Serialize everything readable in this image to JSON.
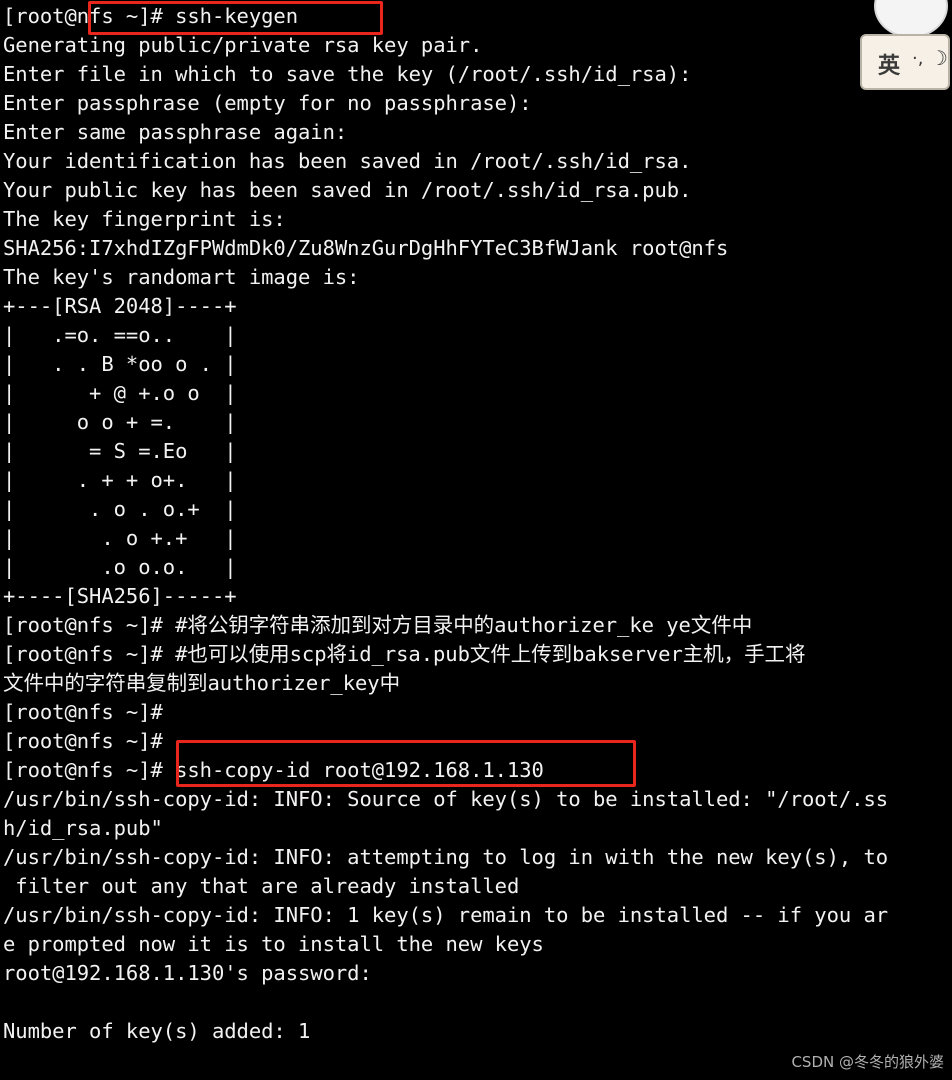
{
  "terminal": {
    "lines": [
      "[root@nfs ~]# ssh-keygen",
      "Generating public/private rsa key pair.",
      "Enter file in which to save the key (/root/.ssh/id_rsa):",
      "Enter passphrase (empty for no passphrase):",
      "Enter same passphrase again:",
      "Your identification has been saved in /root/.ssh/id_rsa.",
      "Your public key has been saved in /root/.ssh/id_rsa.pub.",
      "The key fingerprint is:",
      "SHA256:I7xhdIZgFPWdmDk0/Zu8WnzGurDgHhFYTeC3BfWJank root@nfs",
      "The key's randomart image is:",
      "+---[RSA 2048]----+",
      "|   .=o. ==o..    |",
      "|   . . B *oo o . |",
      "|      + @ +.o o  |",
      "|     o o + =.    |",
      "|      = S =.Eo   |",
      "|     . + + o+.   |",
      "|      . o . o.+  |",
      "|       . o +.+   |",
      "|       .o o.o.   |",
      "+----[SHA256]-----+",
      "[root@nfs ~]# #将公钥字符串添加到对方目录中的authorizer_ke ye文件中",
      "[root@nfs ~]# #也可以使用scp将id_rsa.pub文件上传到bakserver主机，手工将",
      "文件中的字符串复制到authorizer_key中",
      "[root@nfs ~]#",
      "[root@nfs ~]#",
      "[root@nfs ~]# ssh-copy-id root@192.168.1.130",
      "/usr/bin/ssh-copy-id: INFO: Source of key(s) to be installed: \"/root/.ss",
      "h/id_rsa.pub\"",
      "/usr/bin/ssh-copy-id: INFO: attempting to log in with the new key(s), to",
      " filter out any that are already installed",
      "/usr/bin/ssh-copy-id: INFO: 1 key(s) remain to be installed -- if you ar",
      "e prompted now it is to install the new keys",
      "root@192.168.1.130's password:",
      "",
      "Number of key(s) added: 1"
    ]
  },
  "ime": {
    "lang": "英",
    "dots": "·,",
    "moon": "☽"
  },
  "watermark": "CSDN @冬冬的狼外婆",
  "colors": {
    "background": "#000000",
    "text": "#f2f2f2",
    "highlight": "#e8261c"
  }
}
